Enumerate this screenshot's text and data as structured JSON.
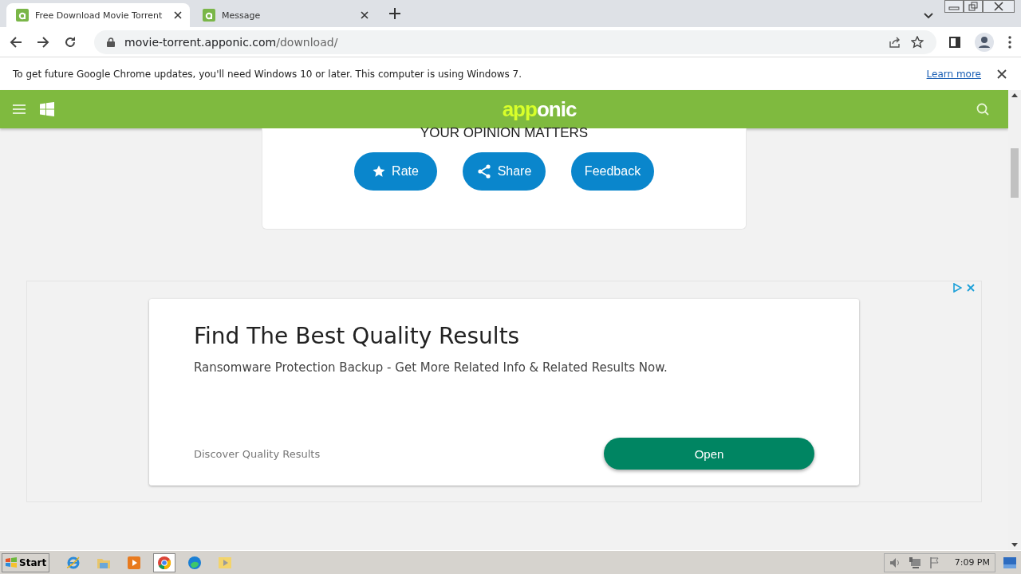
{
  "tabs": [
    {
      "title": "Free Download Movie Torrent",
      "selected": true
    },
    {
      "title": "Message",
      "selected": false
    }
  ],
  "address_bar": {
    "host": "movie-torrent.apponic.com",
    "path": "/download/"
  },
  "infobar": {
    "message": "To get future Google Chrome updates, you'll need Windows 10 or later. This computer is using Windows 7.",
    "link": "Learn more"
  },
  "site_header": {
    "logo_highlight": "app",
    "logo_rest": "onic"
  },
  "opinion_card": {
    "heading": "YOUR OPINION MATTERS",
    "buttons": [
      {
        "label": "Rate",
        "kind": "star"
      },
      {
        "label": "Share",
        "kind": "share"
      },
      {
        "label": "Feedback",
        "kind": "text"
      }
    ]
  },
  "ad": {
    "title": "Find The Best Quality Results",
    "description": "Ransomware Protection Backup - Get More Related Info & Related Results Now.",
    "source": "Discover Quality Results",
    "button": "Open"
  },
  "taskbar": {
    "start": "Start",
    "apps": [
      {
        "kind": "ie",
        "selected": false
      },
      {
        "kind": "folder",
        "selected": false
      },
      {
        "kind": "media",
        "selected": false
      },
      {
        "kind": "chrome",
        "selected": true
      },
      {
        "kind": "edge",
        "selected": false
      },
      {
        "kind": "player",
        "selected": false
      }
    ],
    "clock": "7:09 PM"
  }
}
